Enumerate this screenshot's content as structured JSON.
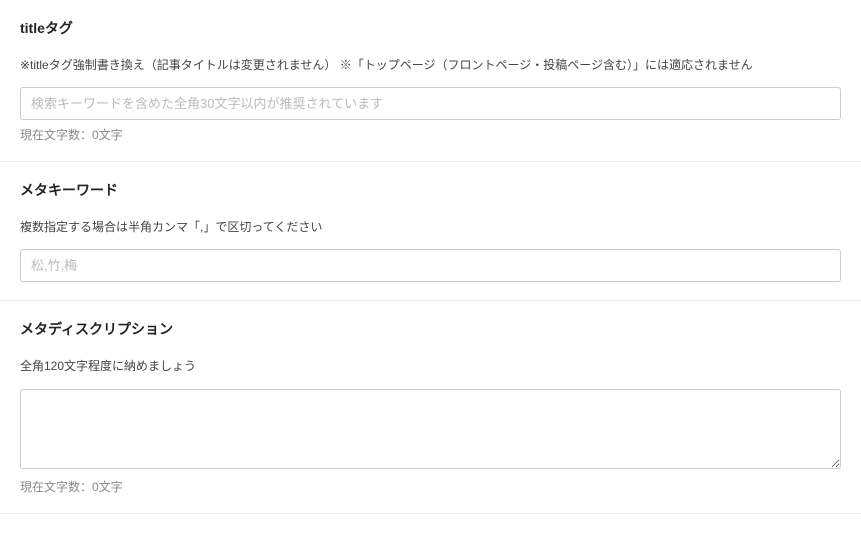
{
  "sections": {
    "title_tag": {
      "heading": "titleタグ",
      "description": "※titleタグ強制書き換え（記事タイトルは変更されません）  ※「トップページ（フロントページ・投稿ページ含む）」には適応されません",
      "placeholder": "検索キーワードを含めた全角30文字以内が推奨されています",
      "value": "",
      "char_count": "現在文字数：0文字"
    },
    "meta_keywords": {
      "heading": "メタキーワード",
      "description": "複数指定する場合は半角カンマ「,」で区切ってください",
      "placeholder": "松,竹,梅",
      "value": ""
    },
    "meta_description": {
      "heading": "メタディスクリプション",
      "description": "全角120文字程度に納めましょう",
      "placeholder": "",
      "value": "",
      "char_count": "現在文字数：0文字"
    }
  }
}
